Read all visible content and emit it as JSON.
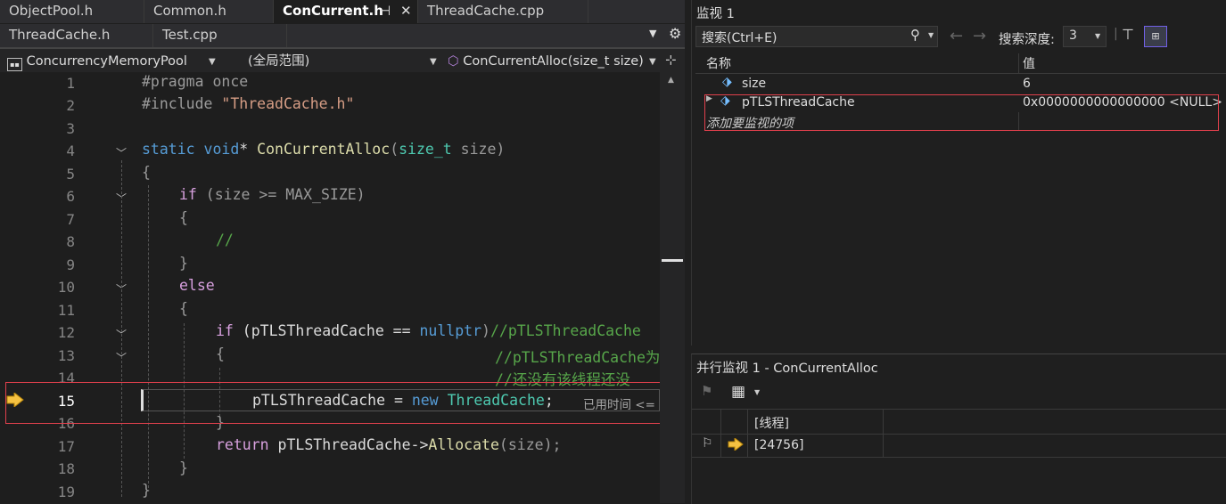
{
  "editor": {
    "tabs_row1": [
      {
        "label": "ObjectPool.h"
      },
      {
        "label": "Common.h"
      },
      {
        "label": "ConCurrent.h"
      },
      {
        "label": "ThreadCache.cpp"
      }
    ],
    "tabs_row2": [
      {
        "label": "ThreadCache.h"
      },
      {
        "label": "Test.cpp"
      }
    ],
    "nav": {
      "project": "ConcurrencyMemoryPool",
      "scope": "(全局范围)",
      "member": "ConCurrentAlloc(size_t size)"
    },
    "line_numbers": [
      "1",
      "2",
      "3",
      "4",
      "5",
      "6",
      "7",
      "8",
      "9",
      "10",
      "11",
      "12",
      "13",
      "14",
      "15",
      "16",
      "17",
      "18",
      "19"
    ],
    "current_line": "15",
    "code": {
      "l1": "#pragma once",
      "l2_directive": "#include ",
      "l2_file": "\"ThreadCache.h\"",
      "l4_static": "static",
      "l4_void": "void",
      "l4_star": "* ",
      "l4_fn": "ConCurrentAlloc",
      "l4_open": "(",
      "l4_type": "size_t",
      "l4_param": " size",
      "l4_close": ")",
      "l5": "{",
      "l6_if": "if",
      "l6_rest": " (size >= MAX_SIZE)",
      "l7": "{",
      "l8": "//",
      "l9": "}",
      "l10": "else",
      "l11": "{",
      "l12_if": "if",
      "l12_rest": " (pTLSThreadCache == ",
      "l12_null": "nullptr",
      "l12_paren": ")",
      "l12_comment": "//pTLSThreadCache",
      "l13_brace": "{",
      "l13_comment": "//pTLSThreadCache为",
      "l14_comment": "//还没有该线程还没",
      "l15_lhs": "pTLSThreadCache = ",
      "l15_new": "new",
      "l15_type": "ThreadCache",
      "l15_semi": ";",
      "l15_hint": "已用时间 <=",
      "l16": "}",
      "l17_return": "return",
      "l17_obj": " pTLSThreadCache->",
      "l17_fn": "Allocate",
      "l17_args": "(size);",
      "l18": "}",
      "l19": "}"
    }
  },
  "watch": {
    "title": "监视 1",
    "search_placeholder": "搜索(Ctrl+E)",
    "depth_label": "搜索深度:",
    "depth_value": "3",
    "col_name": "名称",
    "col_value": "值",
    "rows": [
      {
        "name": "size",
        "value": "6"
      },
      {
        "name": "pTLSThreadCache",
        "value": "0x0000000000000000 <NULL>"
      }
    ],
    "add_item": "添加要监视的项"
  },
  "parallel_watch": {
    "title": "并行监视 1 - ConCurrentAlloc",
    "col_thread": "[线程]",
    "thread_id": "[24756]"
  },
  "colors": {
    "accent_purple": "#7160e8",
    "highlight_red": "#e0404c",
    "arrow_yellow": "#f5c242"
  }
}
